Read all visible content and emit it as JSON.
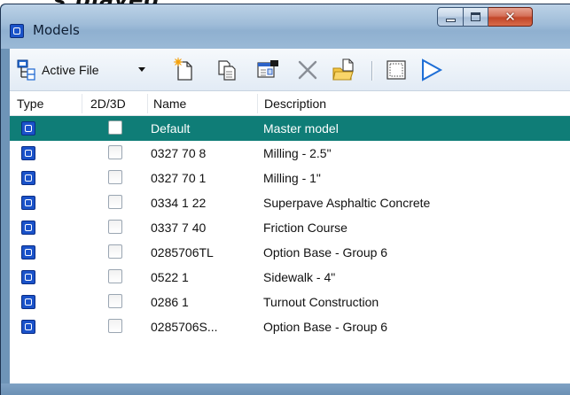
{
  "window": {
    "title": "Models",
    "clipped_text": "s played",
    "caption": {
      "min_label": "",
      "max_label": "",
      "close_glyph": "✕"
    }
  },
  "toolbar": {
    "active_file_label": "Active File",
    "icons": [
      "file-tree-icon",
      "new-model-icon",
      "copy-model-icon",
      "model-properties-icon",
      "delete-icon",
      "import-icon",
      "select-all-icon",
      "reference-icon"
    ]
  },
  "columns": {
    "type": "Type",
    "dim": "2D/3D",
    "name": "Name",
    "description": "Description"
  },
  "rows": [
    {
      "name": "Default",
      "description": "Master model",
      "selected": true
    },
    {
      "name": "0327 70  8",
      "description": "Milling - 2.5\"",
      "selected": false
    },
    {
      "name": "0327 70  1",
      "description": "Milling - 1\"",
      "selected": false
    },
    {
      "name": "0334  1 22",
      "description": "Superpave Asphaltic Concrete",
      "selected": false
    },
    {
      "name": "0337  7 40",
      "description": "Friction Course",
      "selected": false
    },
    {
      "name": "0285706TL",
      "description": "Option Base - Group 6",
      "selected": false
    },
    {
      "name": "0522  1",
      "description": "Sidewalk - 4\"",
      "selected": false
    },
    {
      "name": "0286  1",
      "description": "Turnout Construction",
      "selected": false
    },
    {
      "name": "0285706S...",
      "description": "Option Base - Group 6",
      "selected": false
    }
  ],
  "colors": {
    "selection": "#0f7d77",
    "model_icon": "#1a52c9",
    "title_bar": "#9fbcd8"
  }
}
